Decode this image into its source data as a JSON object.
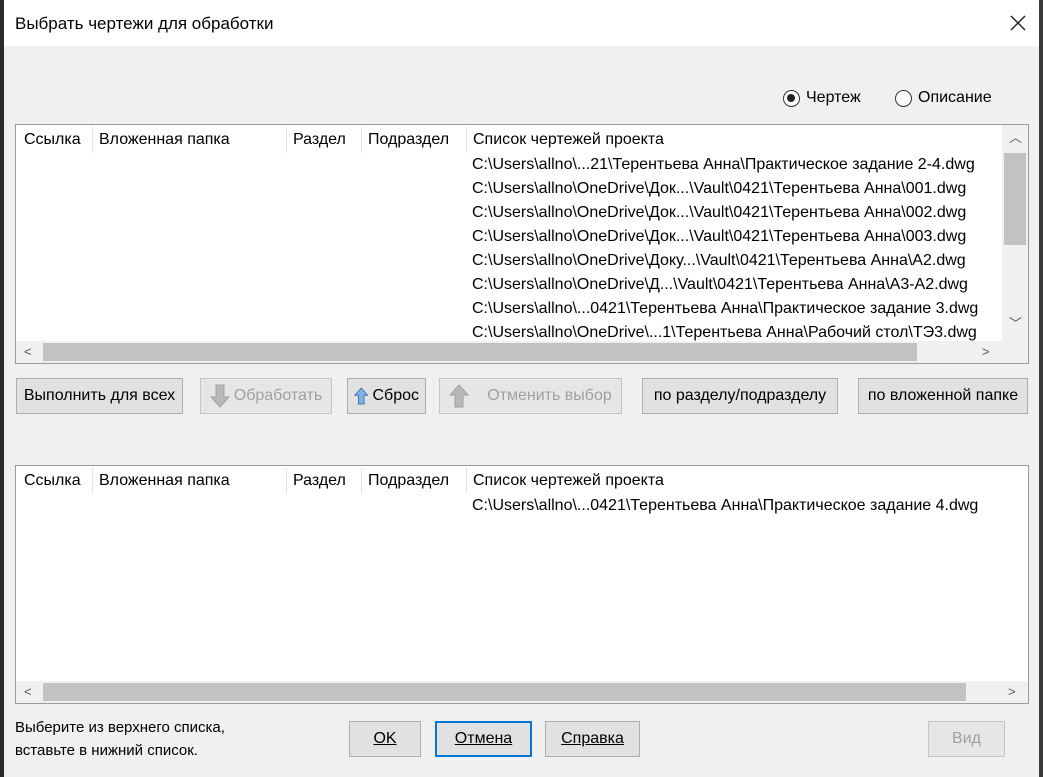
{
  "window": {
    "title": "Выбрать чертежи для обработки"
  },
  "mode": {
    "option_drawing": "Чертеж",
    "option_description": "Описание",
    "selected": "drawing"
  },
  "columns": [
    "Ссылка",
    "Вложенная папка",
    "Раздел",
    "Подраздел",
    "Список чертежей проекта"
  ],
  "top_list": {
    "rows": [
      "C:\\Users\\allno\\...21\\Терентьева Анна\\Практическое задание 2-4.dwg",
      "C:\\Users\\allno\\OneDrive\\Док...\\Vault\\0421\\Терентьева Анна\\001.dwg",
      "C:\\Users\\allno\\OneDrive\\Док...\\Vault\\0421\\Терентьева Анна\\002.dwg",
      "C:\\Users\\allno\\OneDrive\\Док...\\Vault\\0421\\Терентьева Анна\\003.dwg",
      "C:\\Users\\allno\\OneDrive\\Доку...\\Vault\\0421\\Терентьева Анна\\A2.dwg",
      "C:\\Users\\allno\\OneDrive\\Д...\\Vault\\0421\\Терентьева Анна\\A3-A2.dwg",
      "C:\\Users\\allno\\...0421\\Терентьева Анна\\Практическое задание 3.dwg",
      "C:\\Users\\allno\\OneDrive\\...1\\Терентьева Анна\\Рабочий стол\\ТЭ3.dwg"
    ]
  },
  "toolbar": {
    "run_all": "Выполнить для всех",
    "process": "Обработать",
    "reset": "Сброс",
    "cancel_selection": "Отменить выбор",
    "by_section": "по разделу/подразделу",
    "by_folder": "по вложенной папке"
  },
  "bottom_list": {
    "rows": [
      "C:\\Users\\allno\\...0421\\Терентьева Анна\\Практическое задание 4.dwg"
    ]
  },
  "footer": {
    "hint_line1": "Выберите из верхнего списка,",
    "hint_line2": "вставьте в нижний список.",
    "ok_label": "OK",
    "cancel_label": "Отмена",
    "help_label": "Справка",
    "view_label": "Вид"
  }
}
